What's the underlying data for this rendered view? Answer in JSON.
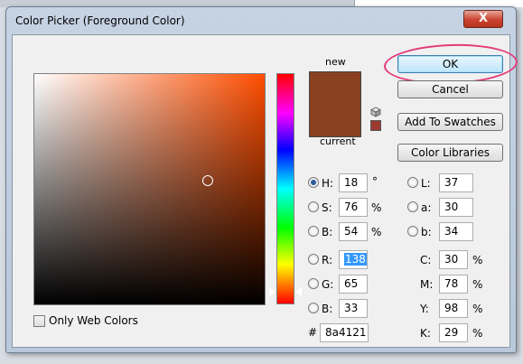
{
  "window": {
    "title": "Color Picker (Foreground Color)",
    "close_label": "X"
  },
  "preview": {
    "new_label": "new",
    "current_label": "current",
    "new_color": "#8a4121",
    "current_color": "#8a4121",
    "gamut_warning_color": "#9a3a30"
  },
  "buttons": {
    "ok": "OK",
    "cancel": "Cancel",
    "add_to_swatches": "Add To Swatches",
    "color_libraries": "Color Libraries"
  },
  "hsb": {
    "h": {
      "label": "H:",
      "value": "18",
      "unit": "°",
      "selected": true
    },
    "s": {
      "label": "S:",
      "value": "76",
      "unit": "%"
    },
    "b": {
      "label": "B:",
      "value": "54",
      "unit": "%"
    }
  },
  "rgb": {
    "r": {
      "label": "R:",
      "value": "138"
    },
    "g": {
      "label": "G:",
      "value": "65"
    },
    "b": {
      "label": "B:",
      "value": "33"
    }
  },
  "lab": {
    "l": {
      "label": "L:",
      "value": "37"
    },
    "a": {
      "label": "a:",
      "value": "30"
    },
    "b": {
      "label": "b:",
      "value": "34"
    }
  },
  "cmyk": {
    "c": {
      "label": "C:",
      "value": "30",
      "unit": "%"
    },
    "m": {
      "label": "M:",
      "value": "78",
      "unit": "%"
    },
    "y": {
      "label": "Y:",
      "value": "98",
      "unit": "%"
    },
    "k": {
      "label": "K:",
      "value": "29",
      "unit": "%"
    }
  },
  "hex": {
    "label": "#",
    "value": "8a4121"
  },
  "only_web_colors": {
    "label": "Only Web Colors",
    "checked": false
  },
  "colors": {
    "accent": "#3c7fb1",
    "annotation": "#e23b7a"
  }
}
